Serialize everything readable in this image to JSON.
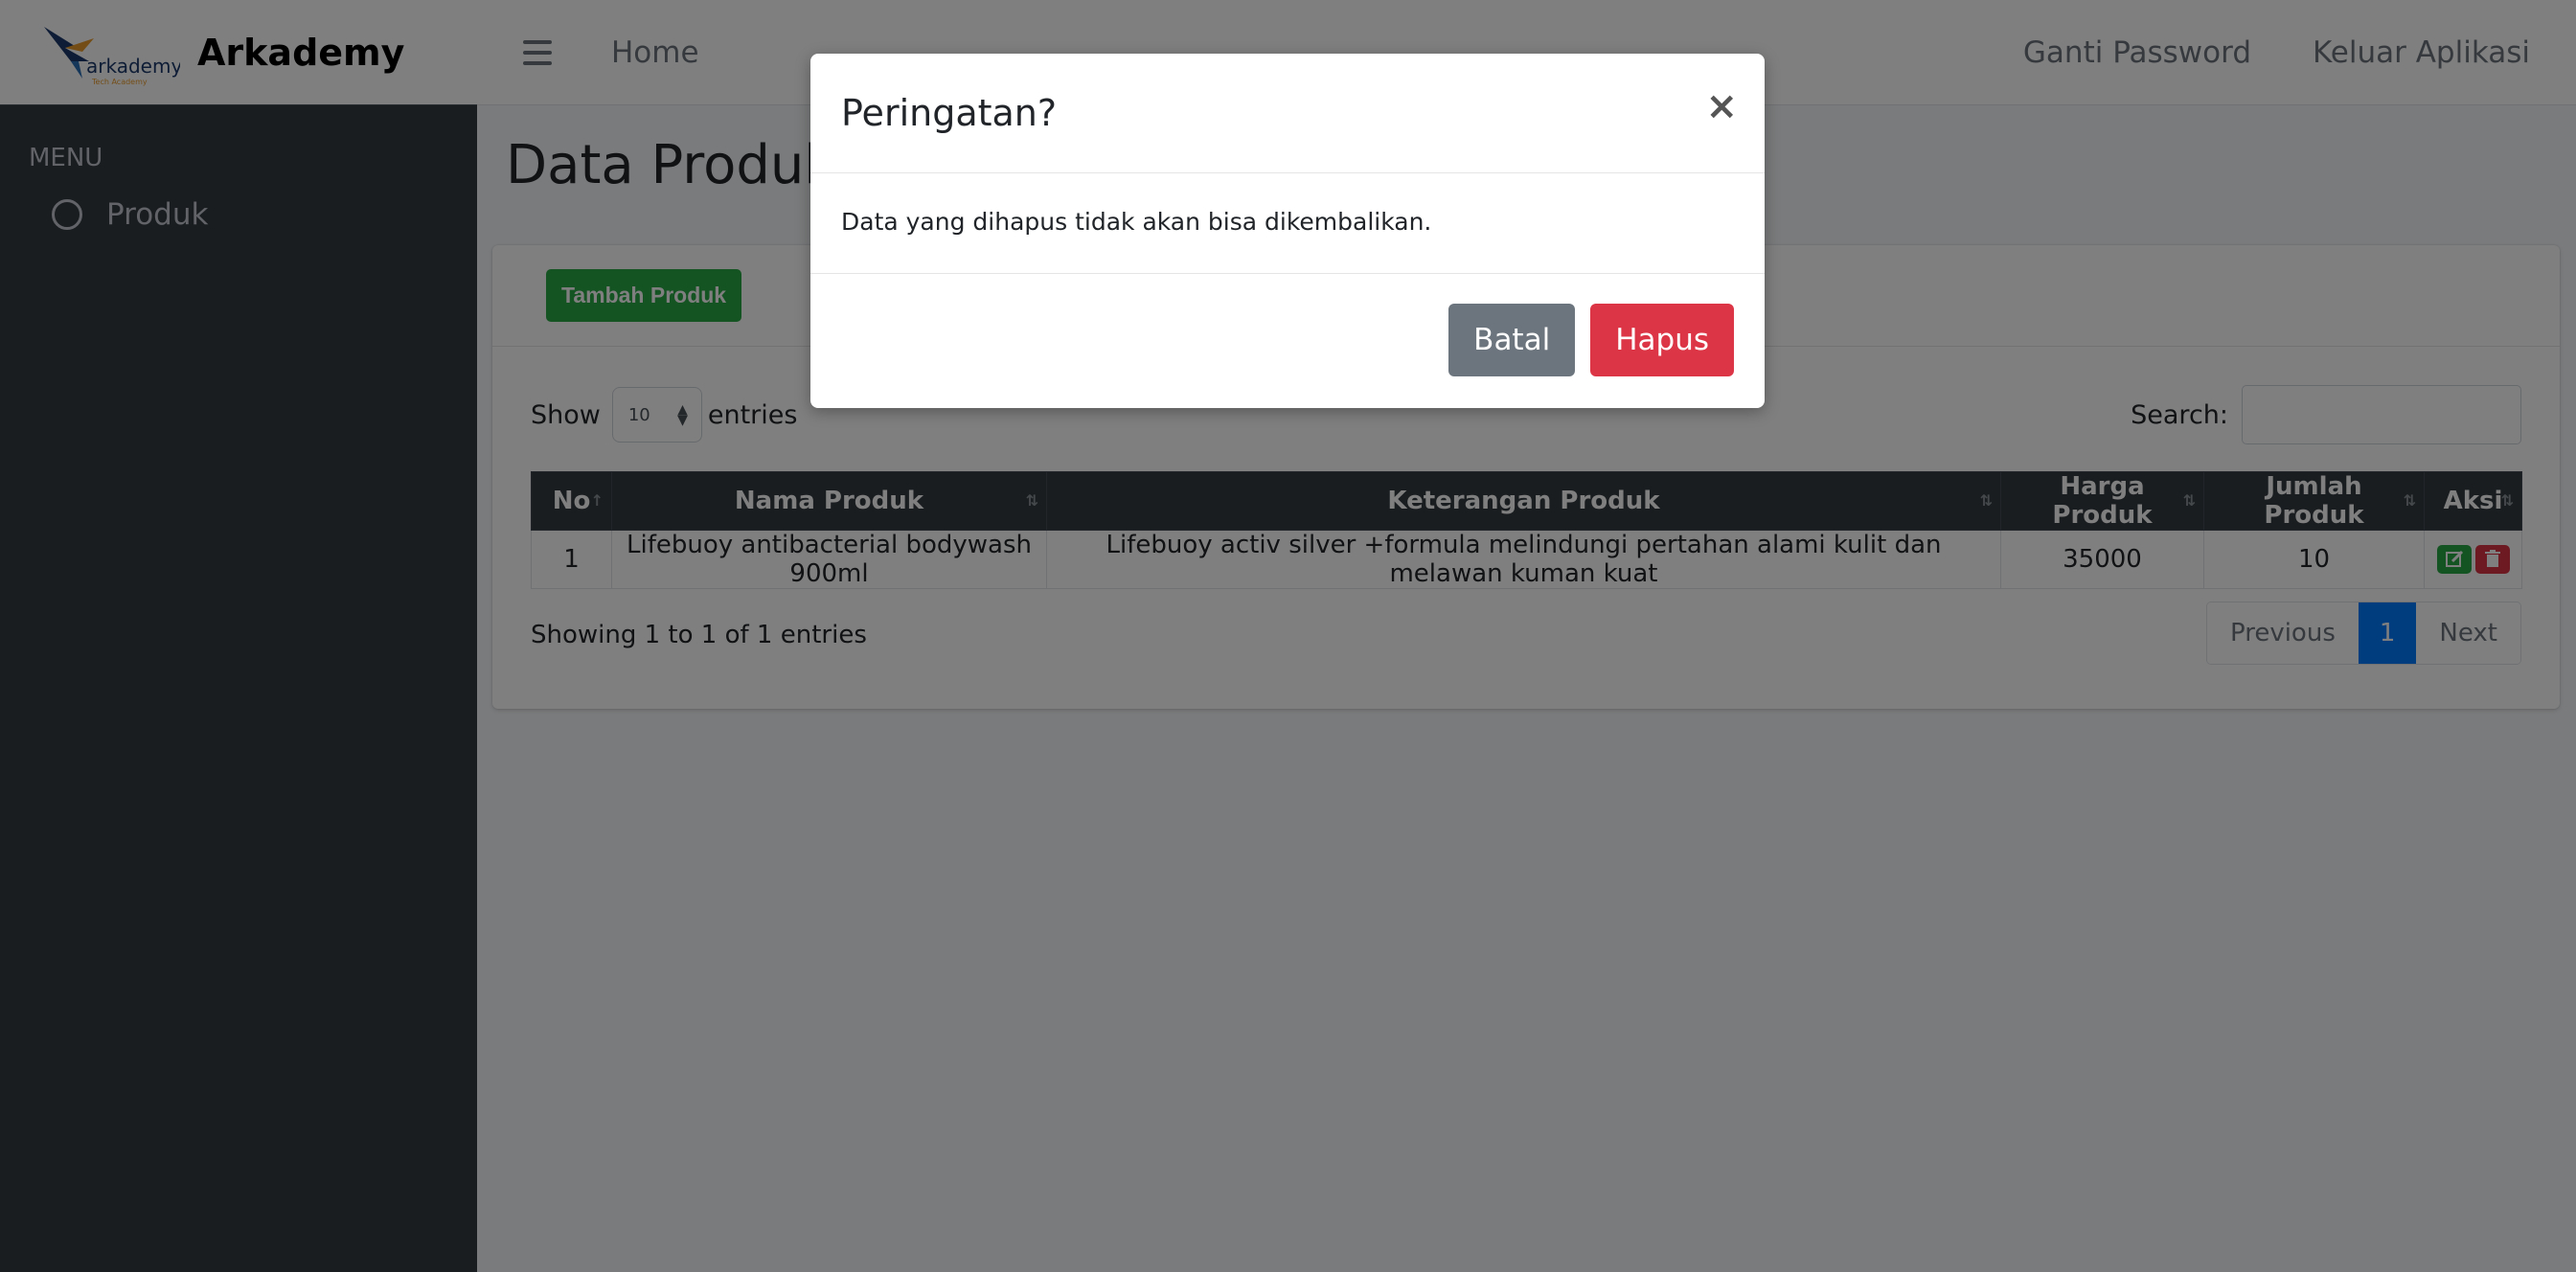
{
  "brand": {
    "logo_text": "arkademy",
    "logo_subtext": "Tech Academy",
    "name": "Arkademy"
  },
  "sidebar": {
    "header": "MENU",
    "items": [
      {
        "label": "Produk"
      }
    ]
  },
  "topbar": {
    "home": "Home",
    "change_password": "Ganti Password",
    "logout": "Keluar Aplikasi"
  },
  "page": {
    "title": "Data Produk"
  },
  "toolbar": {
    "add_label": "Tambah Produk"
  },
  "table_controls": {
    "show_label": "Show",
    "entries_label": "entries",
    "page_length": "10",
    "search_label": "Search:"
  },
  "table": {
    "columns": [
      "No",
      "Nama Produk",
      "Keterangan Produk",
      "Harga Produk",
      "Jumlah Produk",
      "Aksi"
    ],
    "rows": [
      {
        "no": "1",
        "nama": "Lifebuoy antibacterial bodywash 900ml",
        "keterangan": "Lifebuoy activ silver +formula melindungi pertahan alami kulit dan melawan kuman kuat",
        "harga": "35000",
        "jumlah": "10"
      }
    ]
  },
  "pagination": {
    "info": "Showing 1 to 1 of 1 entries",
    "previous": "Previous",
    "current": "1",
    "next": "Next"
  },
  "modal": {
    "title": "Peringatan?",
    "close": "×",
    "message": "Data yang dihapus tidak akan bisa dikembalikan.",
    "cancel": "Batal",
    "confirm": "Hapus"
  },
  "colors": {
    "sidebar": "#343a40",
    "success": "#28a745",
    "danger": "#dc3545",
    "secondary": "#6c757d",
    "primary": "#007bff"
  }
}
